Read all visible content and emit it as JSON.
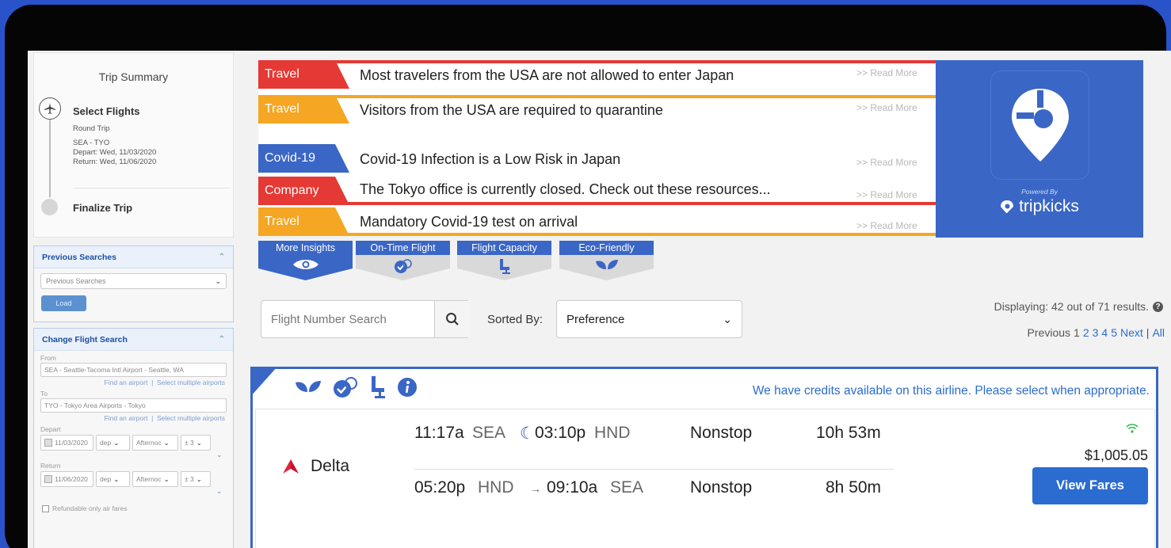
{
  "trip_summary": {
    "title": "Trip Summary",
    "step1": "Select Flights",
    "trip_type": "Round Trip",
    "route": "SEA - TYO",
    "depart": "Depart: Wed, 11/03/2020",
    "return": "Return: Wed, 11/06/2020",
    "step2": "Finalize Trip"
  },
  "previous_searches": {
    "header": "Previous Searches",
    "select_value": "Previous Searches",
    "load_label": "Load"
  },
  "change_search": {
    "header": "Change Flight Search",
    "from_label": "From",
    "from_value": "SEA - Seattle-Tacoma Intl Airport - Seattle, WA",
    "to_label": "To",
    "to_value": "TYO - Tokyo Area Airports - Tokyo",
    "find_airport": "Find an airport",
    "separator": "|",
    "select_multiple": "Select multiple airports",
    "depart_label": "Depart",
    "depart_date": "11/03/2020",
    "return_label": "Return",
    "return_date": "11/06/2020",
    "time_type": "dep",
    "time_of_day": "Afternoc",
    "range": "± 3",
    "refundable": "Refundable only air fares"
  },
  "alerts": [
    {
      "tag": "Travel",
      "color": "#e53935",
      "text": "Most travelers from the USA are not allowed to enter Japan",
      "more": ">> Read More"
    },
    {
      "tag": "Travel",
      "color": "#f5a623",
      "text": "Visitors from the USA are required to quarantine",
      "more": ">> Read More"
    },
    {
      "tag": "Covid-19",
      "color": "#3a66c5",
      "text": "Covid-19 Infection is a Low Risk in Japan",
      "more": ">> Read More"
    },
    {
      "tag": "Company",
      "color": "#e53935",
      "text": "The Tokyo office is currently closed. Check out these resources...",
      "more": ">> Read More"
    },
    {
      "tag": "Travel",
      "color": "#f5a623",
      "text": "Mandatory Covid-19 test on arrival",
      "more": ">> Read More"
    }
  ],
  "brand": {
    "powered_by": "Powered By",
    "name": "tripkicks"
  },
  "tabs": [
    {
      "label": "More Insights",
      "icon": "eye-icon"
    },
    {
      "label": "On-Time Flight",
      "icon": "on-time-icon"
    },
    {
      "label": "Flight Capacity",
      "icon": "seat-icon"
    },
    {
      "label": "Eco-Friendly",
      "icon": "leaves-icon"
    }
  ],
  "search": {
    "placeholder": "Flight Number Search",
    "sorted_by_label": "Sorted By:",
    "sort_value": "Preference",
    "displaying": "Displaying: 42 out of 71 results.",
    "pager": {
      "previous": "Previous",
      "pages": [
        "1",
        "2",
        "3",
        "4",
        "5"
      ],
      "next": "Next",
      "sep": "|",
      "all": "All"
    }
  },
  "result": {
    "credits_note": "We have credits available on this airline. Please select when appropriate.",
    "airline": "Delta",
    "price": "$1,005.05",
    "view_fares": "View Fares",
    "outbound": {
      "dep_time": "11:17a",
      "dep_airport": "SEA",
      "arr_time": "03:10p",
      "arr_airport": "HND",
      "stops": "Nonstop",
      "duration": "10h 53m"
    },
    "inbound": {
      "dep_time": "05:20p",
      "dep_airport": "HND",
      "arrow": "→",
      "arr_time": "09:10a",
      "arr_airport": "SEA",
      "stops": "Nonstop",
      "duration": "8h 50m"
    }
  }
}
